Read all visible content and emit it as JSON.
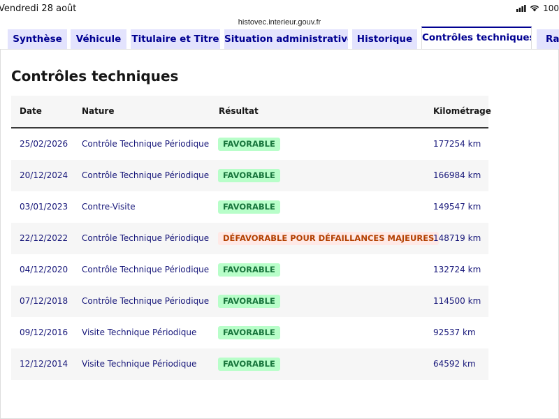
{
  "status_bar": {
    "time": "Vendredi 28 août",
    "battery_text": "100",
    "url": "histovec.interieur.gouv.fr"
  },
  "tabs": [
    {
      "label": "Synthèse",
      "active": false
    },
    {
      "label": "Véhicule",
      "active": false
    },
    {
      "label": "Titulaire et Titre",
      "active": false
    },
    {
      "label": "Situation administrative",
      "active": false
    },
    {
      "label": "Historique",
      "active": false
    },
    {
      "label": "Contrôles techniques",
      "active": true
    },
    {
      "label": "Rap",
      "active": false
    }
  ],
  "section": {
    "title": "Contrôles techniques"
  },
  "table": {
    "headers": [
      "Date",
      "Nature",
      "Résultat",
      "Kilométrage"
    ],
    "rows": [
      {
        "date": "25/02/2026",
        "nature": "Contrôle Technique Périodique",
        "result": "FAVORABLE",
        "status": "ok",
        "km": "177254 km"
      },
      {
        "date": "20/12/2024",
        "nature": "Contrôle Technique Périodique",
        "result": "FAVORABLE",
        "status": "ok",
        "km": "166984 km"
      },
      {
        "date": "03/01/2023",
        "nature": "Contre-Visite",
        "result": "FAVORABLE",
        "status": "ok",
        "km": "149547 km"
      },
      {
        "date": "22/12/2022",
        "nature": "Contrôle Technique Périodique",
        "result": "DÉFAVORABLE POUR DÉFAILLANCES MAJEURES",
        "status": "ko",
        "km": "148719 km"
      },
      {
        "date": "04/12/2020",
        "nature": "Contrôle Technique Périodique",
        "result": "FAVORABLE",
        "status": "ok",
        "km": "132724 km"
      },
      {
        "date": "07/12/2018",
        "nature": "Contrôle Technique Périodique",
        "result": "FAVORABLE",
        "status": "ok",
        "km": "114500 km"
      },
      {
        "date": "09/12/2016",
        "nature": "Visite Technique Périodique",
        "result": "FAVORABLE",
        "status": "ok",
        "km": "92537 km"
      },
      {
        "date": "12/12/2014",
        "nature": "Visite Technique Périodique",
        "result": "FAVORABLE",
        "status": "ok",
        "km": "64592 km"
      }
    ]
  },
  "colors": {
    "brand_blue": "#000091",
    "tab_bg": "#e3e3fd",
    "favorable_bg": "#b8fec9",
    "favorable_text": "#18753c",
    "defavorable_bg": "#ffe9e6",
    "defavorable_text": "#b34000"
  }
}
